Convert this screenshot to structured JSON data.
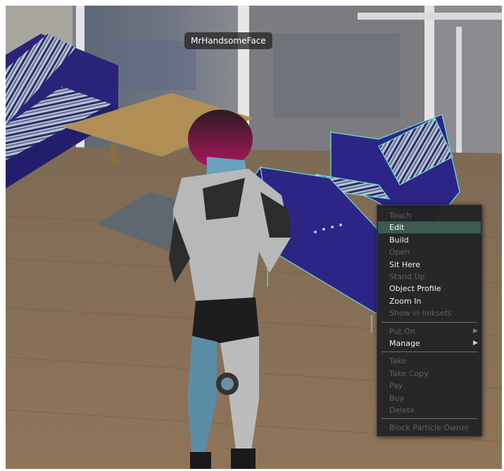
{
  "avatar_name": "MrHandsomeFace",
  "context_menu": {
    "groups": [
      [
        {
          "label": "Touch",
          "enabled": false
        },
        {
          "label": "Edit",
          "enabled": true,
          "highlighted": true
        },
        {
          "label": "Build",
          "enabled": true
        },
        {
          "label": "Open",
          "enabled": false
        },
        {
          "label": "Sit Here",
          "enabled": true
        },
        {
          "label": "Stand Up",
          "enabled": false
        },
        {
          "label": "Object Profile",
          "enabled": true
        },
        {
          "label": "Zoom In",
          "enabled": true
        },
        {
          "label": "Show in linksets",
          "enabled": false
        }
      ],
      [
        {
          "label": "Put On",
          "enabled": false,
          "submenu": true
        },
        {
          "label": "Manage",
          "enabled": true,
          "submenu": true
        }
      ],
      [
        {
          "label": "Take",
          "enabled": false
        },
        {
          "label": "Take Copy",
          "enabled": false
        },
        {
          "label": "Pay",
          "enabled": false
        },
        {
          "label": "Buy",
          "enabled": false
        },
        {
          "label": "Delete",
          "enabled": false
        }
      ],
      [
        {
          "label": "Block Particle Owner",
          "enabled": false
        }
      ]
    ]
  },
  "colors": {
    "menu_bg": "#222424",
    "menu_highlight": "#3c5a50",
    "menu_text": "#f0f0f0",
    "menu_text_disabled": "#5d6362",
    "selection_outline": "#6fe0cf",
    "sofa_blue": "#2c2586"
  }
}
